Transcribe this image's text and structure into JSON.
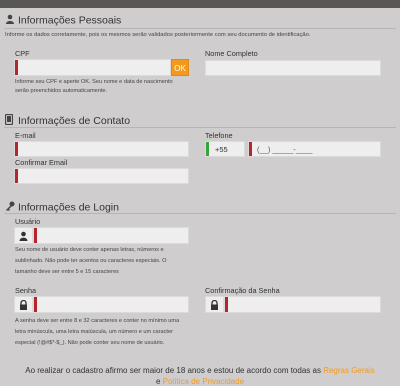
{
  "pessoais": {
    "title": "Informações Pessoais",
    "intro": "Informe os dados corretamente, pois os mesmos serão validados posteriormente com seu documento de identificação.",
    "cpf_label": "CPF",
    "cpf_value": "",
    "ok_label": "OK",
    "cpf_note_line1": "Informe seu CPF e aperte OK. Seu nome e data de nascimento",
    "cpf_note_line2": "serão preenchidos automaticamente.",
    "nome_label": "Nome Completo",
    "nome_value": ""
  },
  "contato": {
    "title": "Informações de Contato",
    "email_label": "E-mail",
    "email_value": "",
    "confirm_email_label": "Confirmar Email",
    "confirm_email_value": "",
    "telefone_label": "Telefone",
    "ddi_value": "+55",
    "telefone_placeholder": "(__) _____-____"
  },
  "login": {
    "title": "Informações de Login",
    "usuario_label": "Usuário",
    "usuario_value": "",
    "usuario_note_line1": "Seu nome de usuário deve conter apenas letras, números e",
    "usuario_note_line2": "sublinhado. Não pode ter acentos ou caracteres especiais. O",
    "usuario_note_line3": "tamanho deve ser entre 5 e 15 caracteres",
    "senha_label": "Senha",
    "senha_value": "",
    "confirm_senha_label": "Confirmação da Senha",
    "confirm_senha_value": "",
    "senha_note_line1": "A senha deve ser entre 8 e 32 caracteres e conter no mínimo uma",
    "senha_note_line2": "letra minúscula, uma letra maiúscula, um número e um caracter",
    "senha_note_line3": "especial (!@#$*-$_). Não pode conter seu nome de usuário."
  },
  "footer": {
    "text": "Ao realizar o cadastro afirmo ser maior de 18 anos e estou de acordo com todas as",
    "link1": "Regras Gerais",
    "conj": "e",
    "link2": "Política de Privacidade"
  },
  "colors": {
    "accent": "#f39a1e",
    "error_mark": "#b3262e",
    "ok_mark": "#3aa33a",
    "background": "#cfcdcd"
  },
  "icons": [
    "user-icon",
    "phone-icon",
    "key-icon",
    "person-icon",
    "lock-icon"
  ]
}
